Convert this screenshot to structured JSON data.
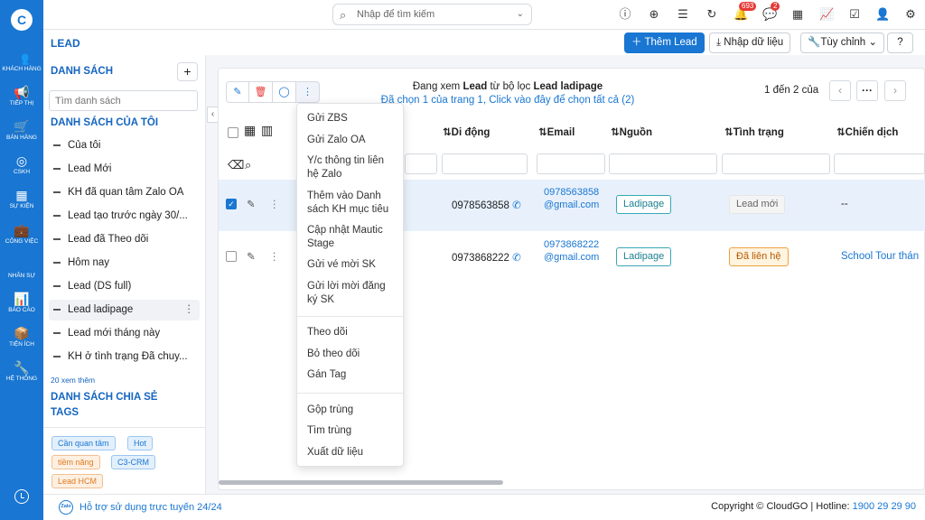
{
  "rail": {
    "logo": "C",
    "items": [
      {
        "label": "KHÁCH HÀNG",
        "icon": "customers-icon"
      },
      {
        "label": "TIẾP THỊ",
        "icon": "megaphone-icon"
      },
      {
        "label": "BÁN HÀNG",
        "icon": "cart-icon"
      },
      {
        "label": "CSKH",
        "icon": "support-icon"
      },
      {
        "label": "SỰ KIỆN",
        "icon": "calendar-icon"
      },
      {
        "label": "CÔNG VIỆC",
        "icon": "briefcase-icon"
      },
      {
        "label": "NHÂN SỰ",
        "icon": "person-icon"
      },
      {
        "label": "BÁO CÁO",
        "icon": "report-icon"
      },
      {
        "label": "TIỆN ÍCH",
        "icon": "box-icon"
      },
      {
        "label": "HỆ THỐNG",
        "icon": "wrench-icon"
      }
    ]
  },
  "topbar": {
    "search_placeholder": "Nhập để tìm kiếm",
    "notifications_count": "693",
    "messages_count": "2"
  },
  "header": {
    "title": "LEAD",
    "add_lead": "Thêm Lead",
    "import_data": "Nhập dữ liệu",
    "customize": "Tùy chỉnh",
    "help": "?"
  },
  "sidebar": {
    "list_heading": "DANH SÁCH",
    "search_placeholder": "Tìm danh sách",
    "my_lists_heading": "DANH SÁCH CỦA TÔI",
    "items": [
      "Của tôi",
      "Lead Mới",
      "KH đã quan tâm Zalo OA",
      "Lead tạo trước ngày 30/...",
      "Lead đã Theo dõi",
      "Hôm nay",
      "Lead (DS full)",
      "Lead ladipage",
      "Lead mới tháng này",
      "KH ở tình trạng Đã chuy..."
    ],
    "selected_index": 7,
    "more": "20 xem thêm",
    "shared_heading": "DANH SÁCH CHIA SẺ",
    "tags_heading": "TAGS",
    "tags": [
      {
        "label": "Cần quan tâm",
        "color": "#1976d2",
        "bg": "#e3f0fc"
      },
      {
        "label": "Hot",
        "color": "#1976d2",
        "bg": "#e3f0fc"
      },
      {
        "label": "tiềm năng",
        "color": "#e07a1f",
        "bg": "#fdf0e2"
      },
      {
        "label": "C3-CRM",
        "color": "#1976d2",
        "bg": "#e3f0fc"
      },
      {
        "label": "Lead HCM",
        "color": "#e07a1f",
        "bg": "#fdf0e2"
      }
    ]
  },
  "main": {
    "info_prefix": "Đang xem ",
    "info_module": "Lead",
    "info_middle": " từ bộ lọc ",
    "info_filter": "Lead ladipage",
    "info_selection": "Đã chọn 1 của trang 1, Click vào đây để chọn tất cả (2)",
    "pagination": "1 đến 2 của",
    "columns": [
      "Di động",
      "Email",
      "Nguồn",
      "Tình trạng",
      "Chiến dịch"
    ],
    "rows": [
      {
        "checked": true,
        "mobile": "0978563858",
        "email": "0978563858@gmail.com",
        "source": "Ladipage",
        "status": "Lead mới",
        "campaign": "--"
      },
      {
        "checked": false,
        "mobile": "0973868222",
        "email": "0973868222@gmail.com",
        "source": "Ladipage",
        "status": "Đã liên hệ",
        "campaign": "School Tour thán"
      }
    ]
  },
  "menu": {
    "items": [
      "Gửi ZBS",
      "Gửi Zalo OA",
      "Y/c thông tin liên hệ Zalo",
      "Thêm vào Danh sách KH mục tiêu",
      "Cập nhật Mautic Stage",
      "Gửi vé mời SK",
      "Gửi lời mời đăng ký SK",
      "Theo dõi",
      "Bỏ theo dõi",
      "Gán Tag",
      "Gộp trùng",
      "Tìm trùng",
      "Xuất dữ liệu"
    ]
  },
  "footer": {
    "zalo": "Zalo",
    "support": "Hỗ trợ sử dụng trực tuyến 24/24",
    "copyright": "Copyright © CloudGO",
    "hotline_label": " | Hotline: ",
    "hotline": "1900 29 29 90"
  }
}
